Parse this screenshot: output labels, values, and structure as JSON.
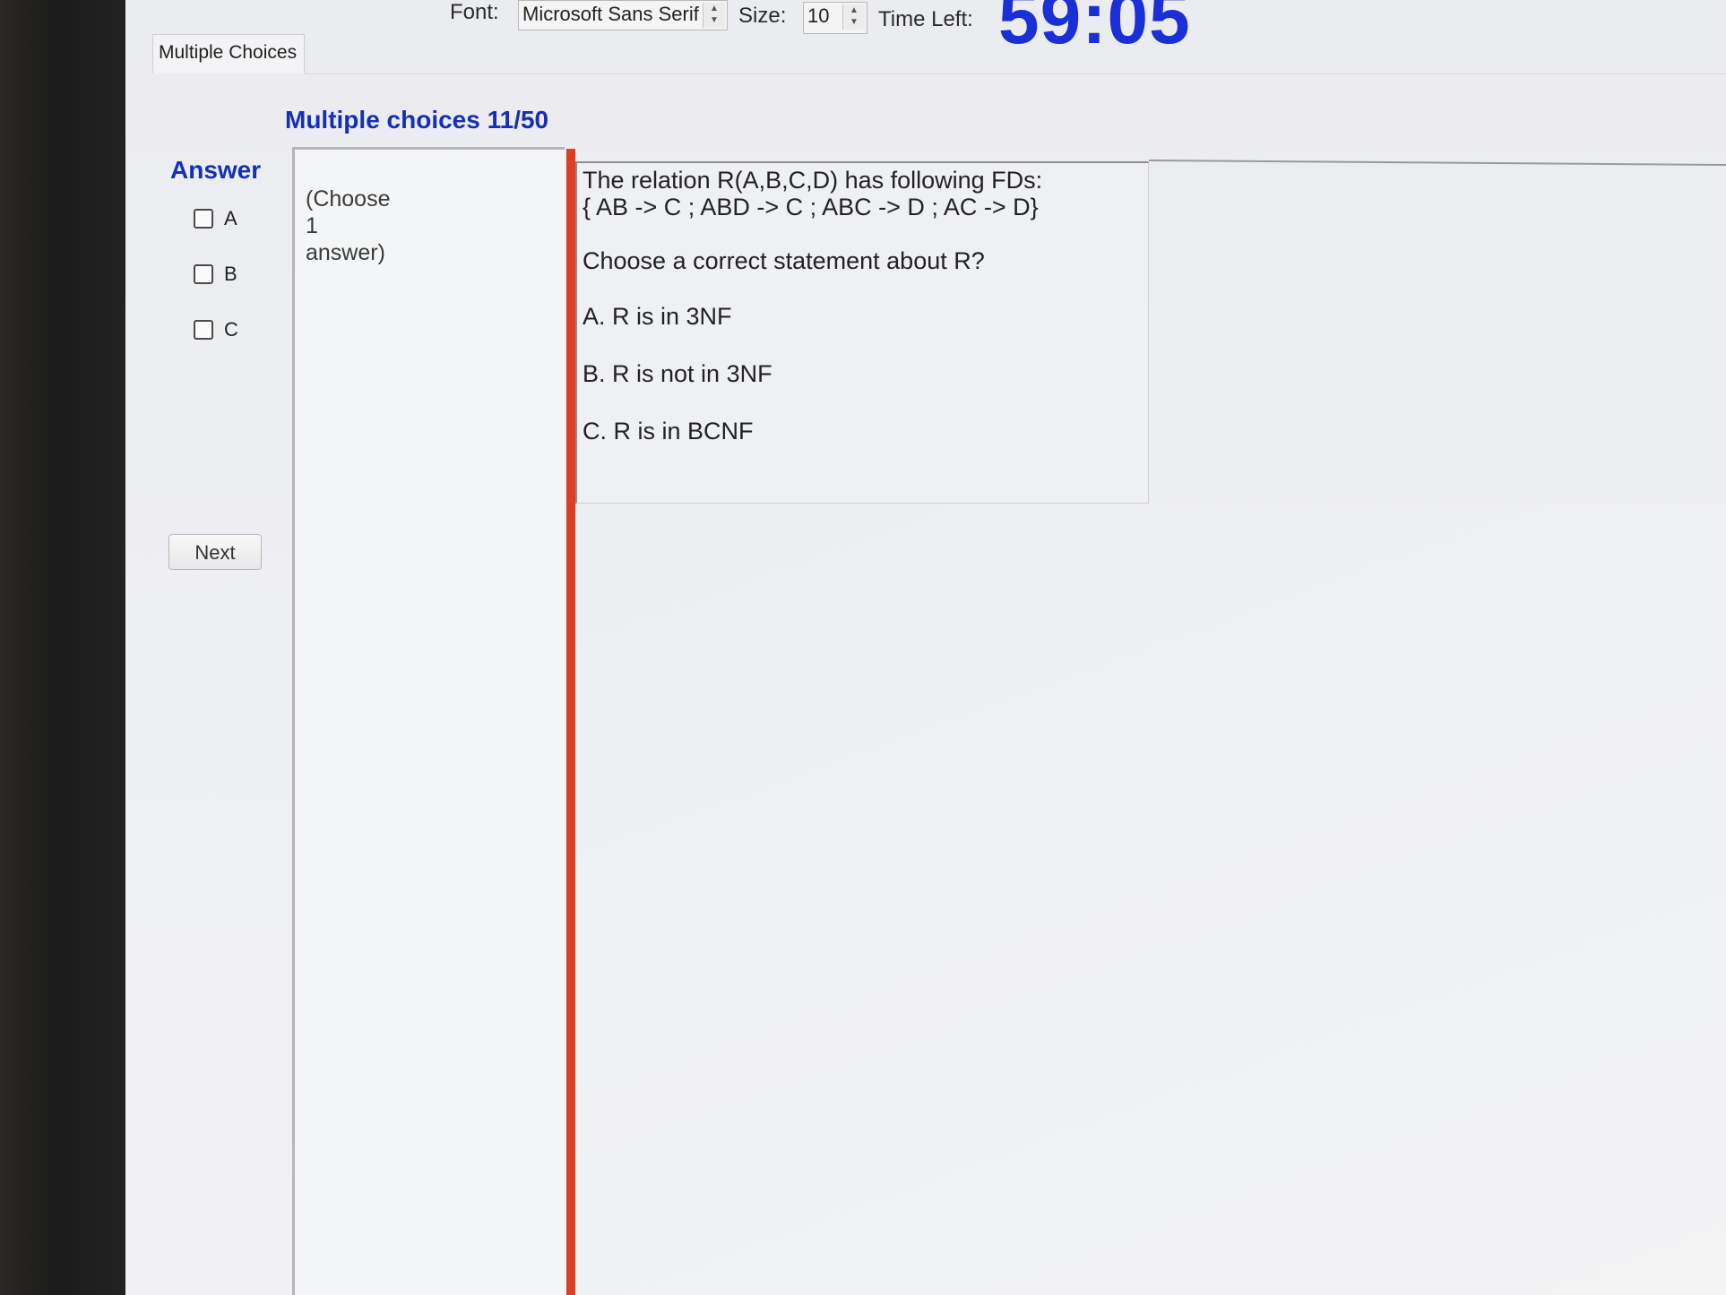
{
  "toolbar": {
    "font_label": "Font:",
    "font_value": "Microsoft Sans Serif",
    "size_label": "Size:",
    "size_value": "10",
    "time_label": "Time Left:",
    "time_value": "59:05"
  },
  "tab": {
    "label": "Multiple Choices"
  },
  "header": {
    "title": "Multiple choices 11/50"
  },
  "answer": {
    "heading": "Answer",
    "options": [
      {
        "label": "A",
        "checked": false
      },
      {
        "label": "B",
        "checked": false
      },
      {
        "label": "C",
        "checked": false
      }
    ],
    "next_label": "Next"
  },
  "instruction": {
    "line1": "(Choose",
    "line2": "1",
    "line3": "answer)"
  },
  "question": {
    "line1": "The relation R(A,B,C,D) has following FDs:",
    "line2": "{ AB -> C ; ABD -> C ; ABC -> D ; AC -> D}",
    "prompt": "Choose a correct statement about R?",
    "choices": [
      "A.  R is in 3NF",
      "B.  R is not in 3NF",
      "C.  R is in BCNF"
    ]
  },
  "colors": {
    "accent_blue": "#1530b8",
    "timer_blue": "#1a2fd6",
    "separator_red": "#d8402a"
  }
}
